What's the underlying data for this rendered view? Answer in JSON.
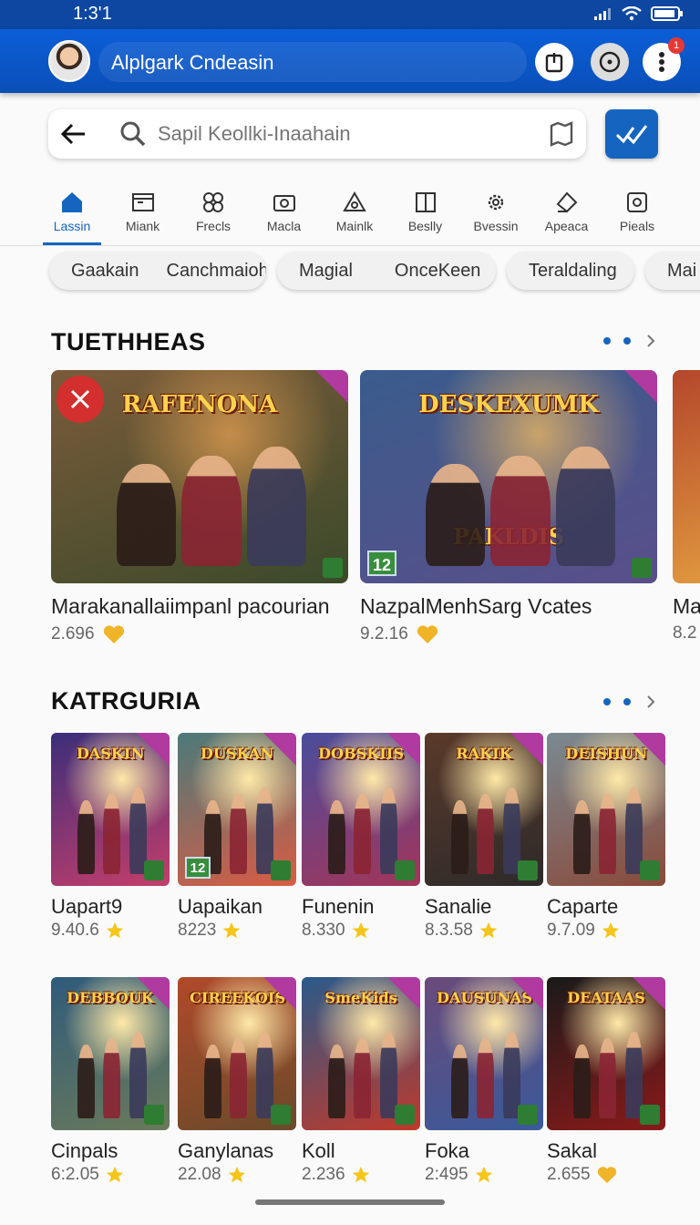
{
  "status_bar": {
    "time": "1:3'1"
  },
  "app_bar": {
    "title": "Alplgark Cndeasin",
    "notification_count": "1"
  },
  "search": {
    "placeholder": "Sapil Keollki-Inaahain"
  },
  "tabs": [
    {
      "label": "Lassin",
      "icon": "home-icon",
      "active": true
    },
    {
      "label": "Miank",
      "icon": "window-icon"
    },
    {
      "label": "Frecls",
      "icon": "clover-icon"
    },
    {
      "label": "Macla",
      "icon": "camera-icon"
    },
    {
      "label": "Mainlk",
      "icon": "triangle-icon"
    },
    {
      "label": "Beslly",
      "icon": "book-icon"
    },
    {
      "label": "Bvessin",
      "icon": "gear-icon"
    },
    {
      "label": "Apeaca",
      "icon": "tag-icon"
    },
    {
      "label": "Pieals",
      "icon": "device-icon"
    }
  ],
  "chips": [
    "Gaakain",
    "Canchmaioh",
    "Magial",
    "OnceKeen",
    "Teraldaling",
    "Mai"
  ],
  "featured": {
    "title": "TUETHHEAS",
    "cards": [
      {
        "title": "Marakanallaiimpanl pacourian",
        "rating": "2.696",
        "art_title": "RAFENONA",
        "rating_badge": "",
        "palette": [
          "#7a5b3a",
          "#3b4a2a",
          "#c58d4a"
        ]
      },
      {
        "title": "NazpalMenhSarg Vcates",
        "rating": "9.2.16",
        "art_title": "DESKEXUMK",
        "art_subtitle": "PAKLDIS",
        "rating_badge": "12",
        "palette": [
          "#3a5c8c",
          "#5a4f8a",
          "#c9a46a"
        ]
      },
      {
        "title": "Ma",
        "rating": "8.2",
        "art_title": "",
        "rating_badge": "",
        "palette": [
          "#b4472c",
          "#f2b845",
          "#ffffff"
        ]
      }
    ]
  },
  "category": {
    "title": "KATRGURIA",
    "row1": [
      {
        "title": "Uapart9",
        "rating": "9.40.6",
        "art_title": "DASKIN",
        "palette": [
          "#3b2e7a",
          "#c43e6b"
        ]
      },
      {
        "title": "Uapaikan",
        "rating": "8223",
        "art_title": "DUSKAN",
        "rating_badge": "12",
        "palette": [
          "#4b7a7a",
          "#d95c44"
        ]
      },
      {
        "title": "Funenin",
        "rating": "8.330",
        "art_title": "DOBSKIIS",
        "palette": [
          "#4a4d9c",
          "#a3355a"
        ]
      },
      {
        "title": "Sanalie",
        "rating": "8.3.58",
        "art_title": "RAKIK",
        "palette": [
          "#5a3a2a",
          "#2d2a2a"
        ]
      },
      {
        "title": "Caparte",
        "rating": "9.7.09",
        "art_title": "DEISHUN",
        "palette": [
          "#7a8a92",
          "#8a4a3a"
        ]
      }
    ],
    "row2": [
      {
        "title": "Cinpals",
        "rating": "6:2.05",
        "art_title": "DEBBOUK",
        "palette": [
          "#2f5b7a",
          "#6a7a5a"
        ]
      },
      {
        "title": "Ganylanas",
        "rating": "22.08",
        "art_title": "CIREEKOIS",
        "palette": [
          "#b04a2a",
          "#6a4a2a"
        ]
      },
      {
        "title": "Koll",
        "rating": "2.236",
        "art_title": "SmeKids",
        "palette": [
          "#2a5a8a",
          "#c0392b"
        ]
      },
      {
        "title": "Foka",
        "rating": "2:495",
        "art_title": "DAUSUNAS",
        "palette": [
          "#6a4a7a",
          "#3a5a9a"
        ]
      },
      {
        "title": "Sakal",
        "rating": "2.655",
        "art_title": "DEATAAS",
        "palette": [
          "#1a1a1a",
          "#8a1a1a"
        ]
      }
    ]
  },
  "colors": {
    "primary": "#1565c0",
    "star": "#f5c518",
    "heart": "#f0b429"
  }
}
